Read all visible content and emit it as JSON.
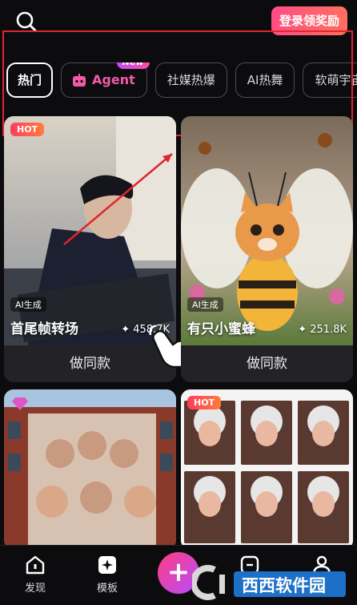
{
  "header": {
    "login_label": "登录领奖励"
  },
  "tabs": [
    {
      "label": "热门",
      "active": true
    },
    {
      "label": "Agent",
      "badge": "New"
    },
    {
      "label": "社媒热爆"
    },
    {
      "label": "AI热舞"
    },
    {
      "label": "软萌宇宙"
    }
  ],
  "cards": [
    {
      "badge": "HOT",
      "ai_label": "AI生成",
      "title": "首尾帧转场",
      "stat": "458.7K",
      "cta": "做同款"
    },
    {
      "ai_label": "AI生成",
      "title": "有只小蜜蜂",
      "stat": "251.8K",
      "cta": "做同款"
    },
    {
      "badge": ""
    },
    {
      "badge": "HOT"
    }
  ],
  "nav": {
    "discover": "发现",
    "templates": "模板",
    "create": "+",
    "me": ""
  },
  "watermark": {
    "text": "西西软件园"
  },
  "colors": {
    "accent": "#ff4d86",
    "highlight": "#e0252d"
  }
}
